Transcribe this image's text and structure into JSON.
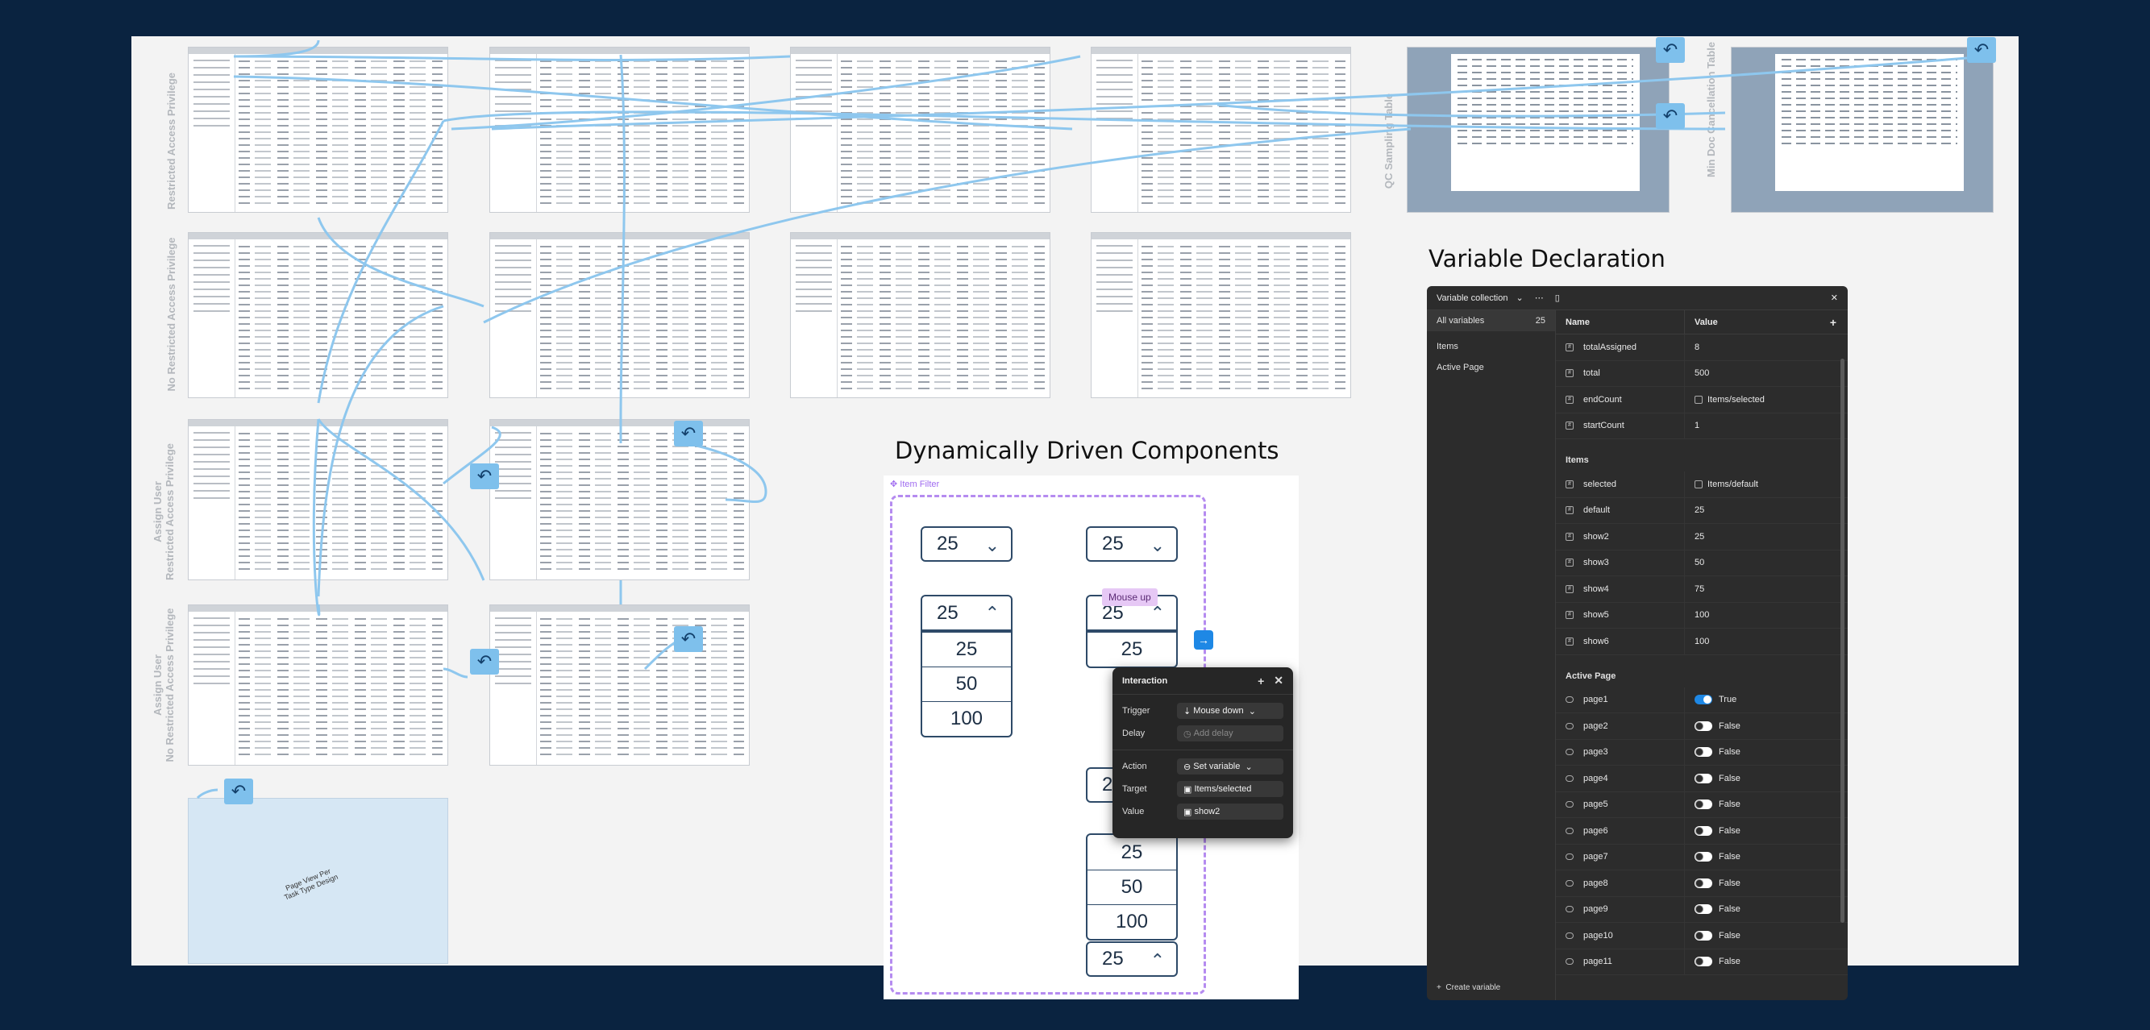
{
  "row_labels": {
    "row1": "Restricted Access Privilege",
    "row2": "No Restricted Access Privilege",
    "row3": [
      "Assign User",
      "Restricted Access Privilege"
    ],
    "row4": [
      "Assign User",
      "No Restricted Access Privilege"
    ],
    "qc": "QC Sampling Table",
    "min_doc": "Min Doc Cancellation Table"
  },
  "page_view_note": "Page View Per Task Type Design",
  "titles": {
    "variable_declaration": "Variable Declaration",
    "dynamic_components": "Dynamically Driven Components"
  },
  "item_filter": {
    "tag": "Item Filter",
    "selected": "25",
    "options": [
      "25",
      "50",
      "100"
    ],
    "mouse_up": "Mouse up"
  },
  "interaction": {
    "title": "Interaction",
    "trigger_label": "Trigger",
    "trigger_value": "Mouse down",
    "delay_label": "Delay",
    "delay_placeholder": "Add delay",
    "action_label": "Action",
    "action_value": "Set variable",
    "target_label": "Target",
    "target_value": "Items/selected",
    "value_label": "Value",
    "value_value": "show2"
  },
  "variable_collection": {
    "title": "Variable collection",
    "groups": [
      {
        "label": "All variables",
        "count": "25"
      },
      {
        "label": "Items"
      },
      {
        "label": "Active Page"
      }
    ],
    "columns": {
      "name": "Name",
      "value": "Value"
    },
    "root_vars": [
      {
        "name": "totalAssigned",
        "value": "8"
      },
      {
        "name": "total",
        "value": "500"
      },
      {
        "name": "endCount",
        "value": "Items/selected"
      },
      {
        "name": "startCount",
        "value": "1"
      }
    ],
    "items_group": "Items",
    "items_vars": [
      {
        "name": "selected",
        "value": "Items/default"
      },
      {
        "name": "default",
        "value": "25"
      },
      {
        "name": "show2",
        "value": "25"
      },
      {
        "name": "show3",
        "value": "50"
      },
      {
        "name": "show4",
        "value": "75"
      },
      {
        "name": "show5",
        "value": "100"
      },
      {
        "name": "show6",
        "value": "100"
      }
    ],
    "active_page_group": "Active Page",
    "page_vars": [
      {
        "name": "page1",
        "value": "True"
      },
      {
        "name": "page2",
        "value": "False"
      },
      {
        "name": "page3",
        "value": "False"
      },
      {
        "name": "page4",
        "value": "False"
      },
      {
        "name": "page5",
        "value": "False"
      },
      {
        "name": "page6",
        "value": "False"
      },
      {
        "name": "page7",
        "value": "False"
      },
      {
        "name": "page8",
        "value": "False"
      },
      {
        "name": "page9",
        "value": "False"
      },
      {
        "name": "page10",
        "value": "False"
      },
      {
        "name": "page11",
        "value": "False"
      }
    ],
    "create_label": "Create variable"
  },
  "colors": {
    "background": "#0a2340",
    "arrow": "#8ec7ee",
    "dashed": "#b58bf0",
    "toggle_on": "#1e88e5"
  }
}
